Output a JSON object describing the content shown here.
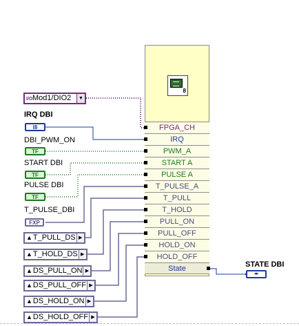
{
  "node": {
    "icon": "fpga-io-node-icon",
    "icon_badge": "8",
    "terminals": [
      {
        "label": "FPGA_CH",
        "color": "#7a2b7a"
      },
      {
        "label": "IRQ",
        "color": "#1d3b9a"
      },
      {
        "label": "PWM_A",
        "color": "#1e7a1e"
      },
      {
        "label": "START A",
        "color": "#1e7a1e"
      },
      {
        "label": "PULSE A",
        "color": "#1e7a1e"
      },
      {
        "label": "T_PULSE_A",
        "color": "#4a4a7a"
      },
      {
        "label": "T_PULL",
        "color": "#4a4a7a"
      },
      {
        "label": "T_HOLD",
        "color": "#4a4a7a"
      },
      {
        "label": "PULL_ON",
        "color": "#4a4a7a"
      },
      {
        "label": "PULL_OFF",
        "color": "#4a4a7a"
      },
      {
        "label": "HOLD_ON",
        "color": "#4a4a7a"
      },
      {
        "label": "HOLD_OFF",
        "color": "#4a4a7a"
      },
      {
        "label": "State",
        "color": "#1d3b9a"
      }
    ]
  },
  "io_control": {
    "small": "I/O",
    "value": "Mod1/DIO2",
    "button": "▼",
    "color": "#7a2b7a"
  },
  "controls": [
    {
      "label": "IRQ DBI",
      "type": "I8",
      "color": "#1d3b9a"
    },
    {
      "label": "DBI_PWM_ON",
      "type": "TF",
      "color": "#1e7a1e"
    },
    {
      "label": "START DBI",
      "type": "TF",
      "color": "#1e7a1e"
    },
    {
      "label": "PULSE DBI",
      "type": "TF",
      "color": "#1e7a1e"
    },
    {
      "label": "T_PULSE_DBI",
      "type": "FXP",
      "color": "#6a6a96"
    }
  ],
  "enum_constants": [
    {
      "cap": "▲",
      "value": "T_PULL_DS",
      "arrow": "▶"
    },
    {
      "cap": "▲",
      "value": "T_HOLD_DS",
      "arrow": "▶"
    },
    {
      "cap": "▲",
      "value": "DS_PULL_ON",
      "arrow": "▶"
    },
    {
      "cap": "▲",
      "value": "DS_PULL_OFF",
      "arrow": "▶"
    },
    {
      "cap": "▲",
      "value": "DS_HOLD_ON",
      "arrow": "▶"
    },
    {
      "cap": "▲",
      "value": "DS_HOLD_OFF",
      "arrow": "▶"
    }
  ],
  "indicator": {
    "label": "STATE DBI",
    "glyph": "◂▸",
    "color": "#1d3b9a"
  },
  "wire_colors": {
    "refnum": "#7a2b7a",
    "i8": "#1d3b9a",
    "boolean": "#1e7a1e",
    "fxp": "#6a6a96"
  }
}
